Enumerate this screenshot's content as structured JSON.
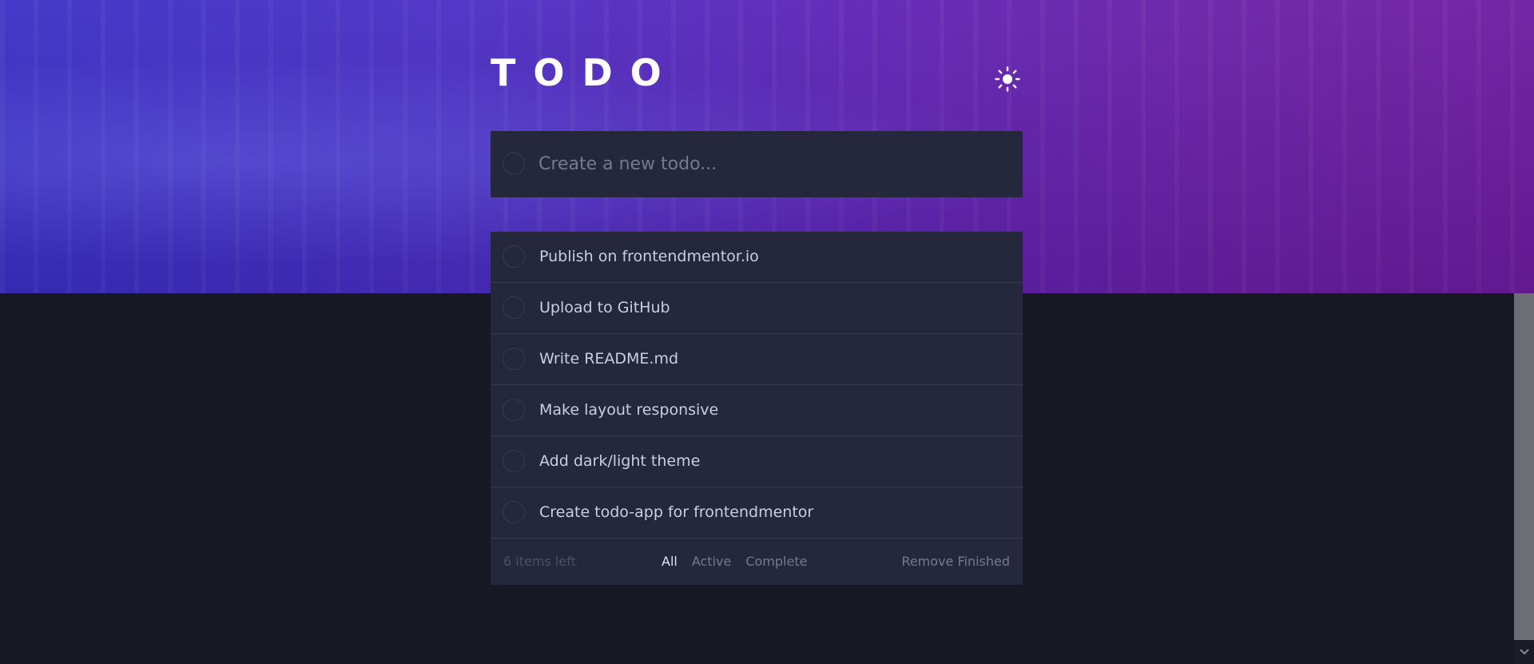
{
  "header": {
    "title": "TODO",
    "theme_toggle_icon": "sun-icon"
  },
  "new_todo": {
    "placeholder": "Create a new todo...",
    "value": ""
  },
  "todos": [
    {
      "text": "Publish on frontendmentor.io",
      "completed": false
    },
    {
      "text": "Upload to GitHub",
      "completed": false
    },
    {
      "text": "Write README.md",
      "completed": false
    },
    {
      "text": "Make layout responsive",
      "completed": false
    },
    {
      "text": "Add dark/light theme",
      "completed": false
    },
    {
      "text": "Create todo-app for frontendmentor",
      "completed": false
    }
  ],
  "footer": {
    "items_left": "6 items left",
    "filters": [
      {
        "label": "All",
        "active": true
      },
      {
        "label": "Active",
        "active": false
      },
      {
        "label": "Complete",
        "active": false
      }
    ],
    "clear_label": "Remove Finished"
  },
  "colors": {
    "background": "#181824",
    "card": "#25273c",
    "text": "#cacde8",
    "muted": "#767992",
    "active_filter": "#e4e5f1"
  }
}
